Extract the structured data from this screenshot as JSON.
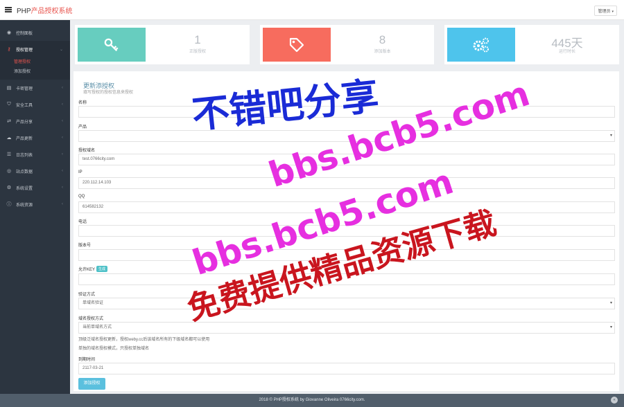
{
  "app": {
    "brand_prefix": "PHP",
    "brand_accent": "产品授权系统",
    "top_right": "管理员",
    "accent_color": "#e8554e"
  },
  "sidebar": {
    "items": [
      {
        "label": "控制面板",
        "icon": "dashboard-icon"
      },
      {
        "label": "授权管理",
        "icon": "key-icon",
        "active": true
      },
      {
        "label": "卡密管理",
        "icon": "card-icon"
      },
      {
        "label": "安全工具",
        "icon": "shield-icon"
      },
      {
        "label": "产品分享",
        "icon": "share-icon"
      },
      {
        "label": "产品更新",
        "icon": "cloud-icon"
      },
      {
        "label": "日志列表",
        "icon": "list-icon"
      },
      {
        "label": "站点数据",
        "icon": "globe-icon"
      },
      {
        "label": "系统设置",
        "icon": "gears-icon"
      },
      {
        "label": "系统资源",
        "icon": "info-icon"
      }
    ],
    "subitems": [
      "管理授权",
      "添加授权"
    ]
  },
  "stats": [
    {
      "value": "1",
      "label": "正版授权",
      "color": "#67cdbf",
      "icon": "key-icon"
    },
    {
      "value": "8",
      "label": "添加版本",
      "color": "#f76c5e",
      "icon": "tags-icon"
    },
    {
      "value": "445天",
      "label": "运行时长",
      "color": "#4ec4ec",
      "icon": "gears-icon"
    }
  ],
  "form": {
    "title": "更新添授权",
    "subtitle": "填写授权的授权信息来授权",
    "fields": [
      {
        "label": "名称",
        "value": ""
      },
      {
        "label": "产品",
        "value": "",
        "select": true
      },
      {
        "label": "授权域名",
        "value": "test.0766city.com"
      },
      {
        "label": "IP",
        "value": "220.112.14.103"
      },
      {
        "label": "QQ",
        "value": "614582132"
      },
      {
        "label": "电话",
        "value": ""
      },
      {
        "label": "版本号",
        "value": ""
      },
      {
        "label": "允许KEY",
        "value": "",
        "badge": "生成"
      },
      {
        "label": "验证方式",
        "value": "单域名验证",
        "select": true
      },
      {
        "label": "域名授权方式",
        "value": "当前单域名方式",
        "select": true
      },
      {
        "label": "到期时间",
        "value": "2117-03-21"
      }
    ],
    "hints": [
      "顶级泛域名授权更新，授权weby.cc后该域名所有的下级域名都可以使用",
      "单独的域名授权模式，只授权单独域名"
    ],
    "submit_label": "添加授权"
  },
  "footer": {
    "text": "2018 © PHP授权系统 by Giovanne Oliveira 0766city.com."
  },
  "watermark": {
    "line1": "不错吧分享",
    "line2": "bbs.bcb5.com",
    "line3": "bbs.bcb5.com",
    "line4": "免费提供精品资源下载"
  }
}
